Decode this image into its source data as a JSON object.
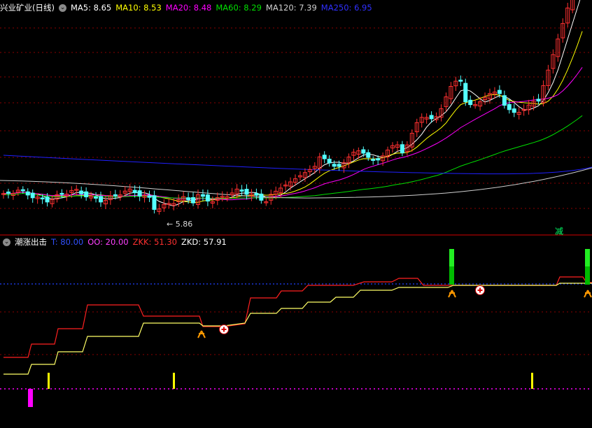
{
  "colors": {
    "background": "#000000",
    "grid": "#8b0000",
    "up": "#ff3030",
    "down": "#54ffff",
    "ma5": "#ffffff",
    "ma10": "#ffff00",
    "ma20": "#ff00ff",
    "ma60": "#00e000",
    "ma120": "#d0d0d0",
    "ma250": "#2020ff",
    "line_t": "#ff2020",
    "line_zkd": "#ffff66",
    "oo_line": "#2040ff",
    "marker_magenta": "#ff00ff",
    "marker_yellow": "#ffff00",
    "marker_green": "#00dd00"
  },
  "main_panel": {
    "title": "兴业矿业(日线)",
    "ma_labels": [
      {
        "text": "MA5: 8.65",
        "color": "#ffffff"
      },
      {
        "text": "MA10: 8.53",
        "color": "#ffff00"
      },
      {
        "text": "MA20: 8.48",
        "color": "#ff00ff"
      },
      {
        "text": "MA60: 8.29",
        "color": "#00e000"
      },
      {
        "text": "MA120: 7.39",
        "color": "#d0d0d0"
      },
      {
        "text": "MA250: 6.95",
        "color": "#3030ff"
      }
    ],
    "low_label": "5.86",
    "signal_label": "减",
    "icon": "chevron-down-icon"
  },
  "indicator_panel": {
    "title": "潮涨出击",
    "labels": [
      {
        "text": "T: 80.00",
        "color": "#3050ff"
      },
      {
        "text": "OO: 20.00",
        "color": "#ff40ff"
      },
      {
        "text": "ZKK: 51.30",
        "color": "#ff3030"
      },
      {
        "text": "ZKD: 57.91",
        "color": "#ffffff"
      }
    ],
    "icon": "chevron-down-icon"
  }
}
